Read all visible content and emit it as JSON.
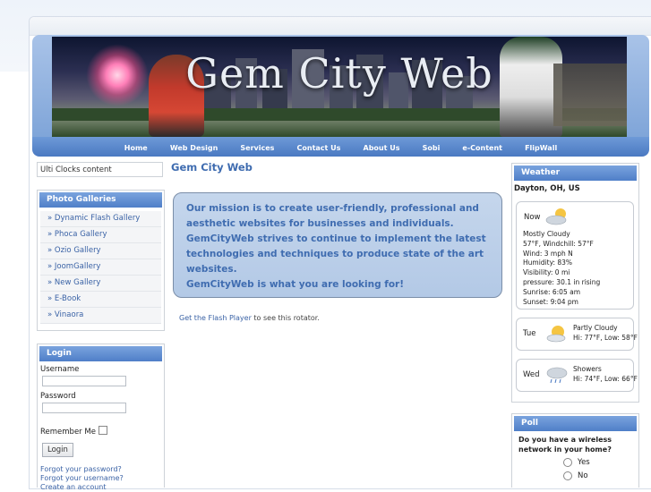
{
  "header": {
    "banner_title": "Gem City Web",
    "nav": [
      "Home",
      "Web Design",
      "Services",
      "Contact Us",
      "About Us",
      "Sobi",
      "e-Content",
      "FlipWall"
    ]
  },
  "left": {
    "ulti_clocks": "Ulti Clocks content",
    "photo_galleries": {
      "title": "Photo Galleries",
      "items": [
        "» Dynamic Flash Gallery",
        "» Phoca Gallery",
        "» Ozio Gallery",
        "» JoomGallery",
        "» New Gallery",
        "» E-Book",
        "» Vinaora"
      ]
    },
    "login": {
      "title": "Login",
      "username_label": "Username",
      "password_label": "Password",
      "remember_label": "Remember Me",
      "button": "Login",
      "links": [
        "Forgot your password?",
        "Forgot your username?",
        "Create an account"
      ]
    }
  },
  "main": {
    "title": "Gem City Web",
    "mission_lines": [
      "Our mission is to create user-friendly, professional and",
      "aesthetic websites for businesses and individuals.",
      "GemCityWeb strives to continue to implement the latest",
      "technologies and techniques to produce state of the art",
      "websites.",
      "GemCityWeb is what you are looking for!"
    ],
    "flash_link": "Get the Flash Player",
    "flash_rest": " to see this rotator."
  },
  "weather": {
    "title": "Weather",
    "location": "Dayton, OH, US",
    "now": {
      "label": "Now",
      "details": [
        "Mostly Cloudy",
        "57°F, Windchill: 57°F",
        "Wind: 3 mph N",
        "Humidity: 83%",
        "Visibility: 0 mi",
        "pressure: 30.1 in rising",
        "Sunrise: 6:05 am",
        "Sunset: 9:04 pm"
      ]
    },
    "forecast": [
      {
        "day": "Tue",
        "desc": "Partly Cloudy",
        "temps": "Hi: 77°F, Low: 58°F"
      },
      {
        "day": "Wed",
        "desc": "Showers",
        "temps": "Hi: 74°F, Low: 66°F"
      }
    ]
  },
  "poll": {
    "title": "Poll",
    "question_lines": [
      "Do you have a wireless",
      "network in your home?"
    ],
    "options": [
      "Yes",
      "No"
    ]
  },
  "colors": {
    "accent": "#4f7fc8",
    "link": "#3b63a6",
    "mission_text": "#3f6cb0"
  }
}
